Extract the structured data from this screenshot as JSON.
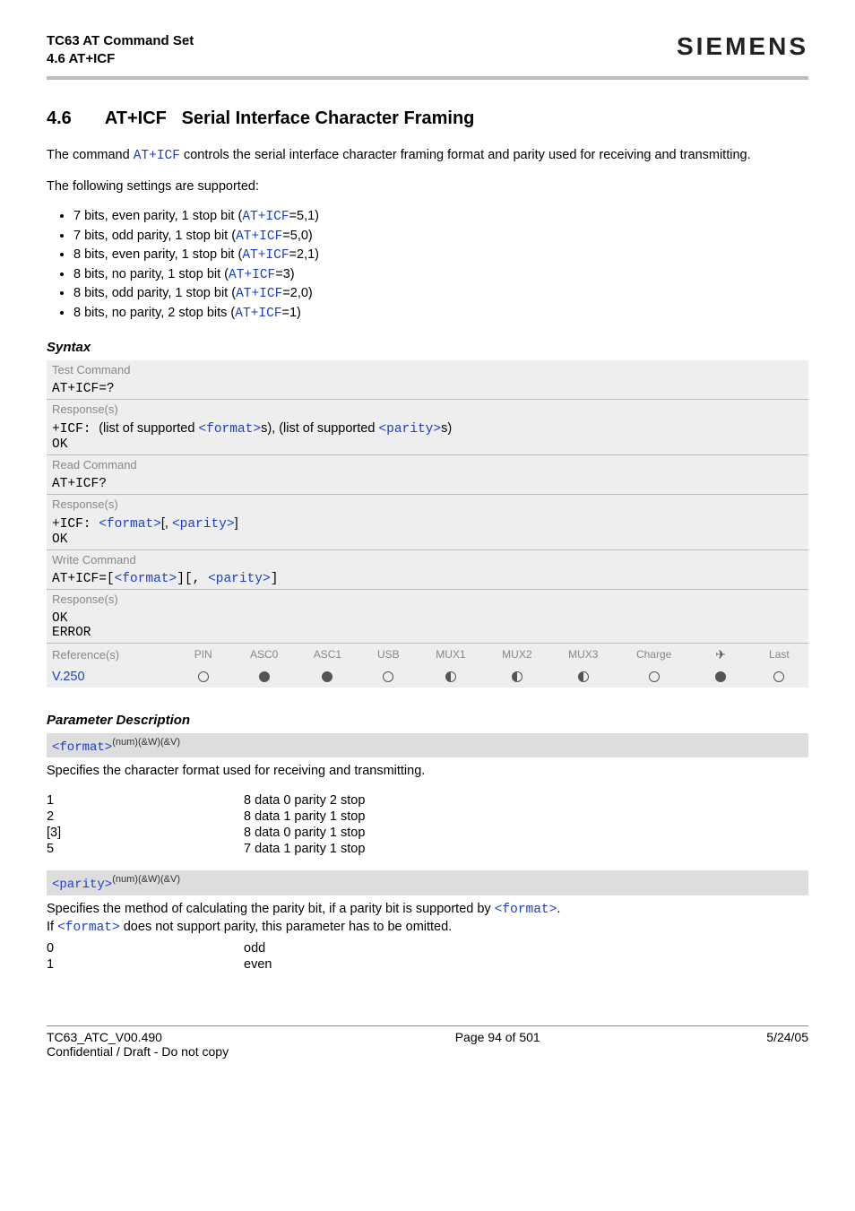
{
  "header": {
    "line1": "TC63 AT Command Set",
    "line2": "4.6 AT+ICF",
    "brand": "SIEMENS"
  },
  "section": {
    "number": "4.6",
    "cmd": "AT+ICF",
    "name": "Serial Interface Character Framing"
  },
  "intro": {
    "p1a": "The command ",
    "p1_cmd": "AT+ICF",
    "p1b": " controls the serial interface character framing format and parity used for receiving and transmitting.",
    "p2": "The following settings are supported:"
  },
  "bullets": [
    {
      "pre": "7 bits, even parity, 1 stop bit (",
      "cmd": "AT+ICF",
      "post": "=5,1)"
    },
    {
      "pre": "7 bits, odd parity, 1 stop bit (",
      "cmd": "AT+ICF",
      "post": "=5,0)"
    },
    {
      "pre": "8 bits, even parity, 1 stop bit (",
      "cmd": "AT+ICF",
      "post": "=2,1)"
    },
    {
      "pre": "8 bits, no parity, 1 stop bit (",
      "cmd": "AT+ICF",
      "post": "=3)"
    },
    {
      "pre": "8 bits, odd parity, 1 stop bit (",
      "cmd": "AT+ICF",
      "post": "=2,0)"
    },
    {
      "pre": "8 bits, no parity, 2 stop bits (",
      "cmd": "AT+ICF",
      "post": "=1)"
    }
  ],
  "syntax_label": "Syntax",
  "syntax": {
    "test_lbl": "Test Command",
    "test_cmd": "AT+ICF=?",
    "test_resp_lbl": "Response(s)",
    "test_resp_a": "+ICF: ",
    "test_resp_b": "(list of supported ",
    "test_resp_fmt": "<format>",
    "test_resp_c": "s), (list of supported ",
    "test_resp_par": "<parity>",
    "test_resp_d": "s)",
    "ok": "OK",
    "read_lbl": "Read Command",
    "read_cmd": "AT+ICF?",
    "read_resp_lbl": "Response(s)",
    "read_resp_a": "+ICF: ",
    "read_resp_fmt": "<format>",
    "read_resp_b": "[, ",
    "read_resp_par": "<parity>",
    "read_resp_c": "]",
    "write_lbl": "Write Command",
    "write_cmd_a": "AT+ICF=[",
    "write_cmd_fmt": "<format>",
    "write_cmd_b": "][, ",
    "write_cmd_par": "<parity>",
    "write_cmd_c": "]",
    "write_resp_lbl": "Response(s)",
    "error": "ERROR",
    "ref_lbl": "Reference(s)",
    "ref_cols": [
      "PIN",
      "ASC0",
      "ASC1",
      "USB",
      "MUX1",
      "MUX2",
      "MUX3",
      "Charge",
      "✈",
      "Last"
    ],
    "ref_val": "V.250",
    "ref_icons": [
      "empty",
      "full",
      "full",
      "empty",
      "half",
      "half",
      "half",
      "empty",
      "full",
      "empty"
    ]
  },
  "param_desc_label": "Parameter Description",
  "params": {
    "format": {
      "name": "<format>",
      "flags": "(num)(&W)(&V)",
      "desc": "Specifies the character format used for receiving and transmitting.",
      "rows": [
        {
          "k": "1",
          "v": "8 data 0 parity 2 stop"
        },
        {
          "k": "2",
          "v": "8 data 1 parity 1 stop"
        },
        {
          "k": "[3]",
          "v": "8 data 0 parity 1 stop"
        },
        {
          "k": "5",
          "v": "7 data 1 parity 1 stop"
        }
      ]
    },
    "parity": {
      "name": "<parity>",
      "flags": "(num)(&W)(&V)",
      "desc_a": "Specifies the method of calculating the parity bit, if a parity bit is supported by ",
      "desc_fmt": "<format>",
      "desc_b": ".",
      "desc_c": "If ",
      "desc_fmt2": "<format>",
      "desc_d": " does not support parity, this parameter has to be omitted.",
      "rows": [
        {
          "k": "0",
          "v": "odd"
        },
        {
          "k": "1",
          "v": "even"
        }
      ]
    }
  },
  "footer": {
    "left1": "TC63_ATC_V00.490",
    "left2": "Confidential / Draft - Do not copy",
    "center": "Page 94 of 501",
    "right": "5/24/05"
  }
}
